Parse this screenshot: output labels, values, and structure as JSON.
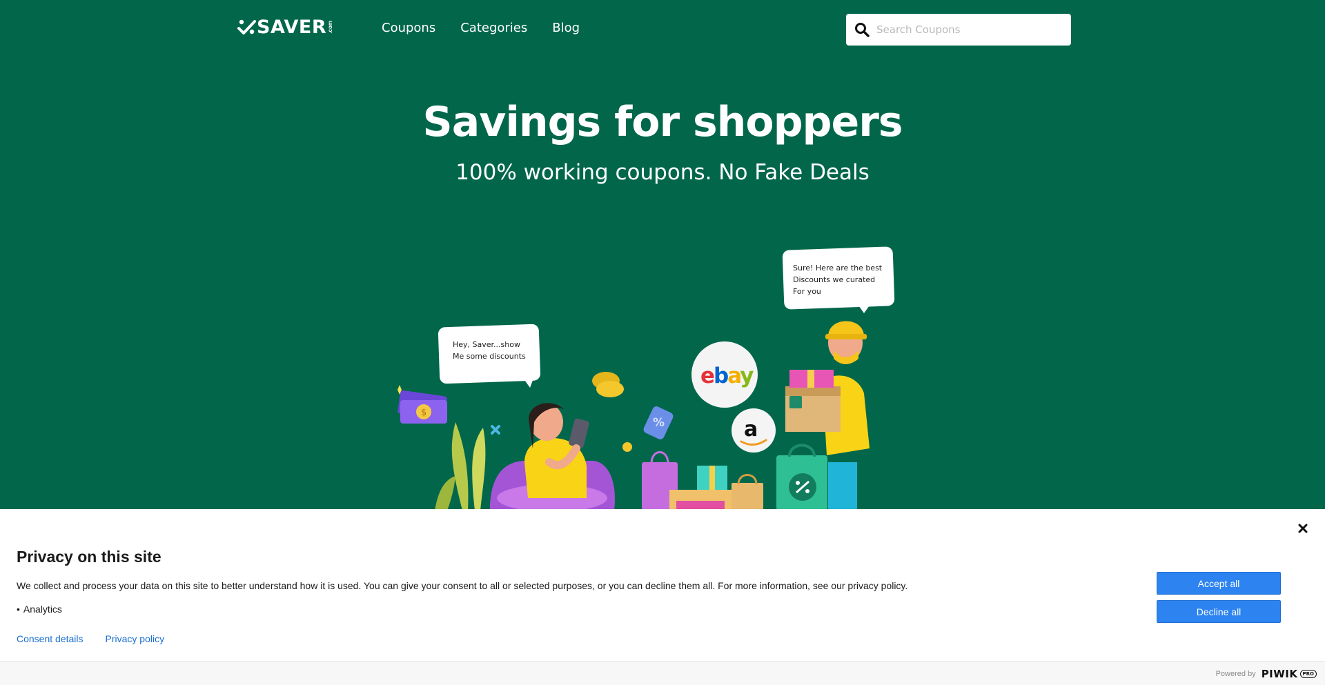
{
  "header": {
    "logo_text": "SAVER",
    "logo_suffix": ".com",
    "nav": [
      {
        "label": "Coupons"
      },
      {
        "label": "Categories"
      },
      {
        "label": "Blog"
      }
    ],
    "search": {
      "placeholder": "Search Coupons",
      "value": ""
    }
  },
  "hero": {
    "title": "Savings for shoppers",
    "subtitle": "100% working coupons. No Fake Deals",
    "bubble_left": [
      "Hey, Saver...show",
      "Me some discounts"
    ],
    "bubble_right": [
      "Sure! Here are the best",
      "Discounts we curated",
      "For you"
    ],
    "brands": [
      "ebay",
      "a"
    ]
  },
  "consent": {
    "title": "Privacy on this site",
    "description": "We collect and process your data on this site to better understand how it is used. You can give your consent to all or selected purposes, or you can decline them all. For more information, see our privacy policy.",
    "purposes": [
      {
        "bullet": "•",
        "label": "Analytics"
      }
    ],
    "links": [
      {
        "label": "Consent details"
      },
      {
        "label": "Privacy policy"
      }
    ],
    "accept_label": "Accept all",
    "decline_label": "Decline all",
    "powered_by": "Powered by",
    "powered_brand": "PIWIK",
    "powered_brand_suffix": "PRO"
  },
  "colors": {
    "brand_green": "#02674a",
    "button_blue": "#2d83f0",
    "link_blue": "#1a6fcf"
  }
}
